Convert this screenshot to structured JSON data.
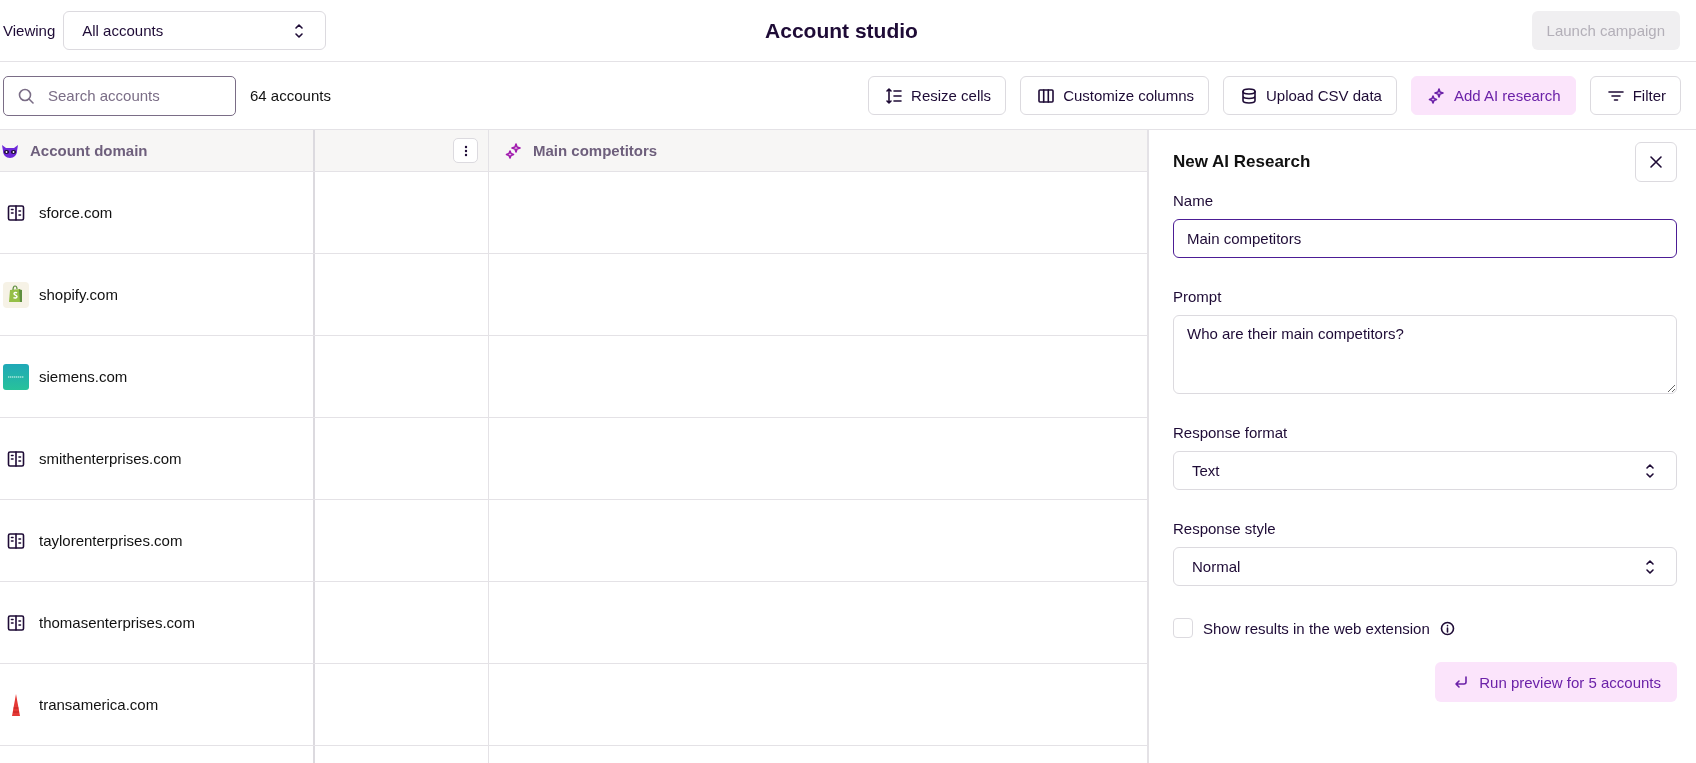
{
  "top_bar": {
    "viewing_label": "Viewing",
    "view_select": {
      "value": "All accounts"
    },
    "title": "Account studio",
    "launch_button": {
      "label": "Launch campaign",
      "disabled": true
    }
  },
  "toolbar": {
    "search": {
      "placeholder": "Search accounts"
    },
    "count": "64 accounts",
    "buttons": [
      {
        "kind": "resize",
        "label": "Resize cells",
        "active": false
      },
      {
        "kind": "columns",
        "label": "Customize columns",
        "active": false
      },
      {
        "kind": "database",
        "label": "Upload CSV data",
        "active": false
      },
      {
        "kind": "sparkle",
        "label": "Add AI research",
        "active": true
      },
      {
        "kind": "filter",
        "label": "Filter",
        "active": false
      }
    ]
  },
  "table": {
    "columns": [
      {
        "kind": "mascot",
        "label": "Account domain"
      },
      {
        "kind": "menu"
      },
      {
        "kind": "sparkle",
        "label": "Main competitors"
      }
    ],
    "rows": [
      {
        "kind": "building",
        "domain": "sforce.com"
      },
      {
        "kind": "bag",
        "domain": "shopify.com"
      },
      {
        "kind": "square",
        "domain": "siemens.com"
      },
      {
        "kind": "building",
        "domain": "smithenterprises.com"
      },
      {
        "kind": "building",
        "domain": "taylorenterprises.com"
      },
      {
        "kind": "building",
        "domain": "thomasenterprises.com"
      },
      {
        "kind": "tower",
        "domain": "transamerica.com"
      }
    ]
  },
  "panel": {
    "title": "New AI Research",
    "fields": [
      {
        "kind": "input",
        "label": "Name",
        "value": "Main competitors"
      },
      {
        "kind": "textarea",
        "label": "Prompt",
        "value": "Who are their main competitors?"
      },
      {
        "kind": "select",
        "label": "Response format",
        "value": "Text"
      },
      {
        "kind": "select",
        "label": "Response style",
        "value": "Normal"
      }
    ],
    "checkbox": {
      "label": "Show results in the web extension",
      "checked": false
    },
    "run_button": {
      "label": "Run preview for 5 accounts"
    }
  }
}
